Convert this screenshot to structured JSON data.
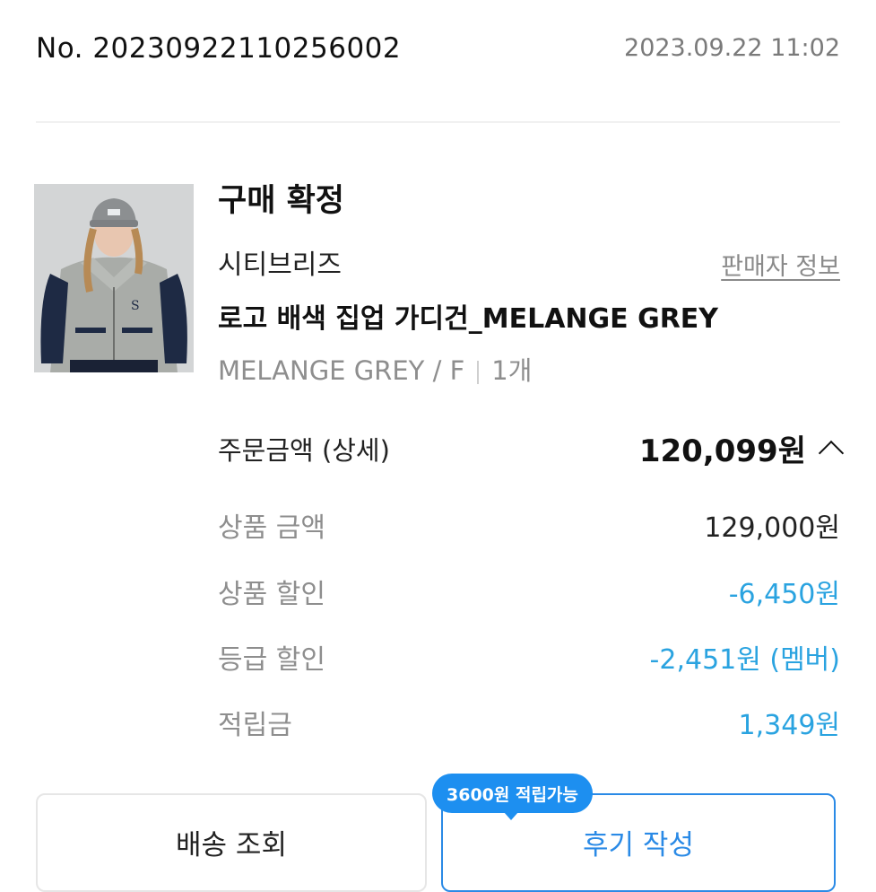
{
  "order": {
    "number": "No. 20230922110256002",
    "date": "2023.09.22 11:02"
  },
  "product": {
    "status": "구매 확정",
    "brand": "시티브리즈",
    "seller_info_link": "판매자 정보",
    "name": "로고 배색 집업 가디건_MELANGE GREY",
    "option": "MELANGE GREY / F",
    "quantity": "1개"
  },
  "payment": {
    "total_label": "주문금액 (상세)",
    "total_value": "120,099원",
    "lines": [
      {
        "label": "상품 금액",
        "value": "129,000원"
      },
      {
        "label": "상품 할인",
        "value": "-6,450원"
      },
      {
        "label": "등급 할인",
        "value": "-2,451원 (멤버)"
      },
      {
        "label": "적립금",
        "value": "1,349원"
      }
    ]
  },
  "actions": {
    "shipping_label": "배송 조회",
    "review_label": "후기 작성",
    "review_badge": "3600원 적립가능"
  },
  "colors": {
    "accent_blue": "#2aa3e0",
    "button_blue": "#2a8ae6",
    "badge_blue": "#1d8ff0"
  }
}
